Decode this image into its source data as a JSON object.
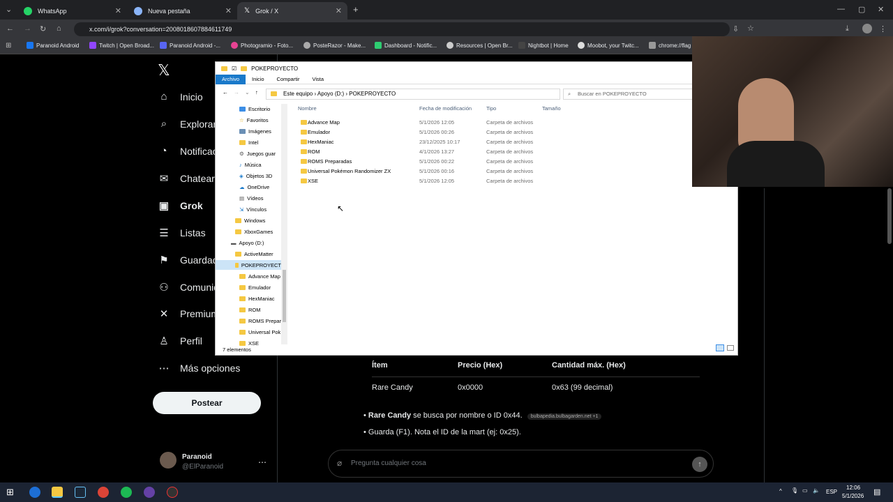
{
  "tabs": [
    {
      "label": "WhatsApp",
      "color": "#25d366"
    },
    {
      "label": "Nueva pestaña",
      "color": "#8ab4f8"
    },
    {
      "label": "Grok / X",
      "color": "#ffffff"
    }
  ],
  "url": "x.com/i/grok?conversation=2008018607884611749",
  "bookmarks": [
    "Paranoid Android",
    "Twitch | Open Broad...",
    "Paranoid Android -...",
    "Photogramio - Foto...",
    "PosteRazor - Make...",
    "Dashboard - Notific...",
    "Resources | Open Br...",
    "Nightbot | Home",
    "Moobot, your Twitc...",
    "chrome://flag"
  ],
  "x_nav": [
    {
      "label": "Inicio",
      "icon": "home-icon",
      "glyph": "⌂"
    },
    {
      "label": "Explorar",
      "icon": "search-icon",
      "glyph": "⌕"
    },
    {
      "label": "Notificaciones",
      "icon": "bell-icon",
      "glyph": "🔔"
    },
    {
      "label": "Chatear",
      "icon": "mail-icon",
      "glyph": "✉"
    },
    {
      "label": "Grok",
      "icon": "grok-icon",
      "glyph": "▣"
    },
    {
      "label": "Listas",
      "icon": "list-icon",
      "glyph": "☰"
    },
    {
      "label": "Guardados",
      "icon": "bookmark-icon",
      "glyph": "⚑"
    },
    {
      "label": "Comunidades",
      "icon": "people-icon",
      "glyph": "👥"
    },
    {
      "label": "Premium",
      "icon": "x-icon",
      "glyph": "✕"
    },
    {
      "label": "Perfil",
      "icon": "user-icon",
      "glyph": "👤"
    },
    {
      "label": "Más opciones",
      "icon": "more-icon",
      "glyph": "⋯"
    }
  ],
  "post_button": "Postear",
  "profile": {
    "name": "Paranoid",
    "handle": "@ElParanoid"
  },
  "grok_table": {
    "headers": [
      "Ítem",
      "Precio (Hex)",
      "Cantidad máx. (Hex)"
    ],
    "row": [
      "Rare Candy",
      "0x0000",
      "0x63 (99 decimal)"
    ]
  },
  "bullets": [
    {
      "bold": "Rare Candy",
      "text": " se busca por nombre o ID 0x44.",
      "source": "bulbapedia.bulbagarden.net +1"
    },
    {
      "bold": "",
      "text": "Guarda (F1). Nota el ID de la mart (ej: 0x25).",
      "source": ""
    }
  ],
  "ask_placeholder": "Pregunta cualquier cosa",
  "explorer": {
    "title": "POKEPROYECTO",
    "ribbon": [
      "Archivo",
      "Inicio",
      "Compartir",
      "Vista"
    ],
    "crumbs": "Este equipo  ›  Apoyo (D:)  ›  POKEPROYECTO",
    "search_placeholder": "Buscar en POKEPROYECTO",
    "columns": [
      "Nombre",
      "Fecha de modificación",
      "Tipo",
      "Tamaño"
    ],
    "files": [
      {
        "name": "Advance Map",
        "date": "5/1/2026 12:05",
        "type": "Carpeta de archivos"
      },
      {
        "name": "Emulador",
        "date": "5/1/2026 00:26",
        "type": "Carpeta de archivos"
      },
      {
        "name": "HexManiac",
        "date": "23/12/2025 10:17",
        "type": "Carpeta de archivos"
      },
      {
        "name": "ROM",
        "date": "4/1/2026 13:27",
        "type": "Carpeta de archivos"
      },
      {
        "name": "ROMS Preparadas",
        "date": "5/1/2026 00:22",
        "type": "Carpeta de archivos"
      },
      {
        "name": "Universal Pokémon Randomizer ZX",
        "date": "5/1/2026 00:16",
        "type": "Carpeta de archivos"
      },
      {
        "name": "XSE",
        "date": "5/1/2026 12:05",
        "type": "Carpeta de archivos"
      }
    ],
    "nav": [
      "Escritorio",
      "Favoritos",
      "Imágenes",
      "Intel",
      "Juegos guar",
      "Música",
      "Objetos 3D",
      "OneDrive",
      "Vídeos",
      "Vínculos",
      "Windows",
      "XboxGames",
      "Apoyo (D:)",
      "ActiveMatter",
      "POKEPROYECT",
      "Advance Map",
      "Emulador",
      "HexManiac",
      "ROM",
      "ROMS Prepar",
      "Universal Pok",
      "XSE"
    ],
    "status": "7 elementos"
  },
  "tray": {
    "lang": "ESP",
    "time": "12:06",
    "date": "5/1/2026"
  }
}
